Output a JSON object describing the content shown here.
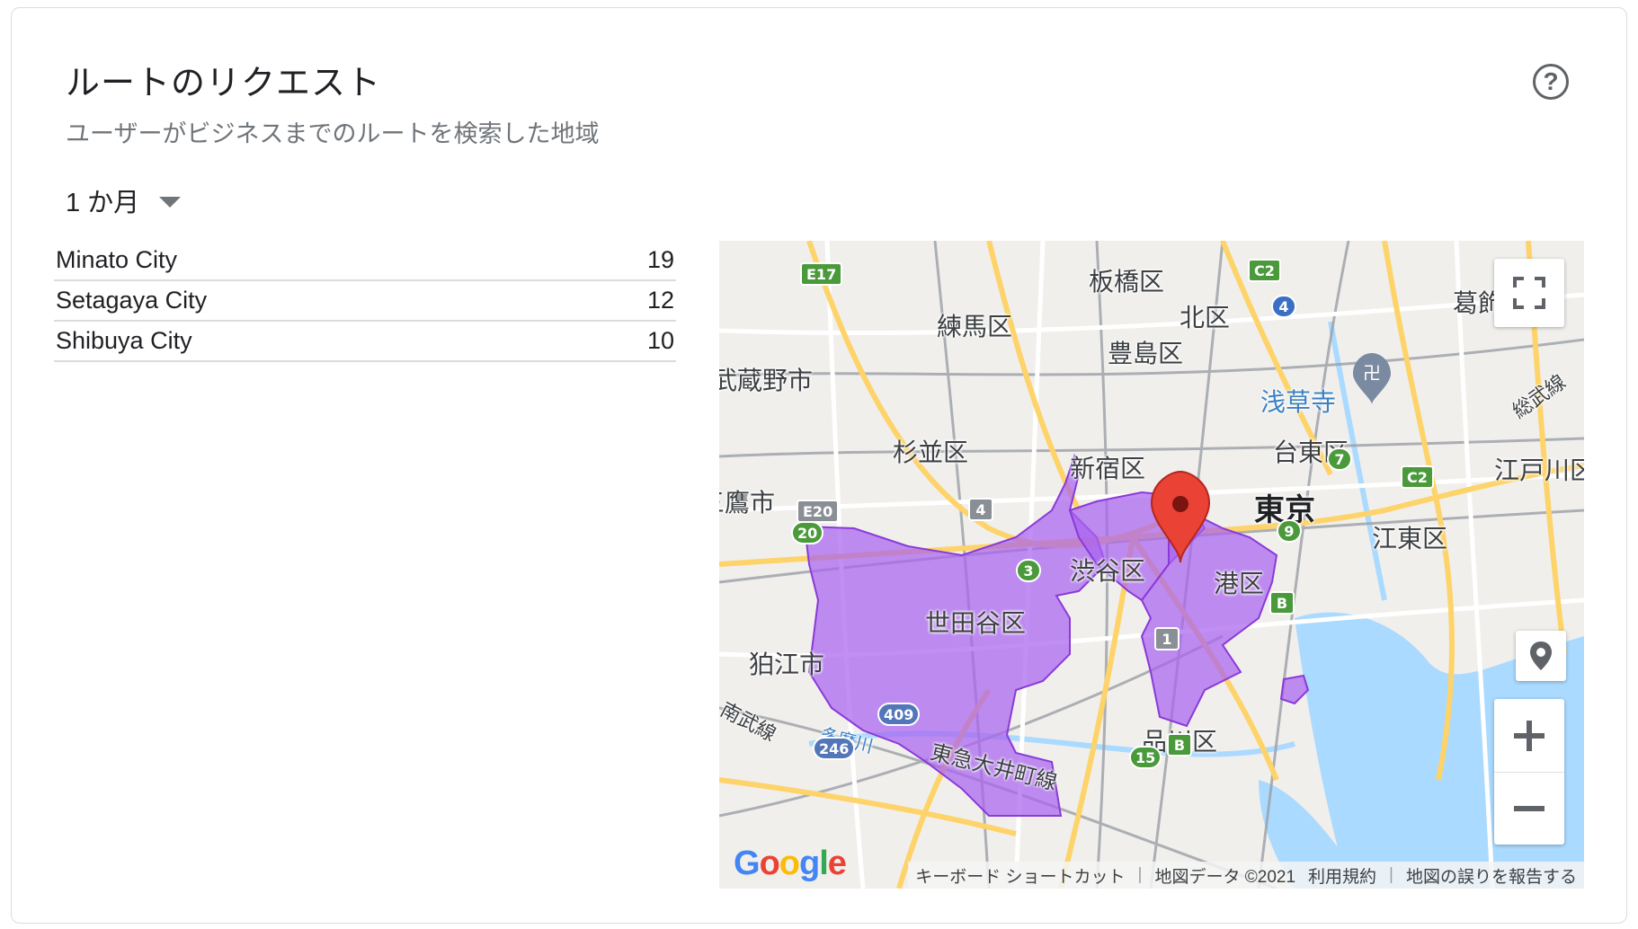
{
  "card": {
    "title": "ルートのリクエスト",
    "subtitle": "ユーザーがビジネスまでのルートを検索した地域",
    "period": "1 か月"
  },
  "list": {
    "rows": [
      {
        "name": "Minato City",
        "count": "19"
      },
      {
        "name": "Setagaya City",
        "count": "12"
      },
      {
        "name": "Shibuya City",
        "count": "10"
      }
    ]
  },
  "map": {
    "labels": {
      "itabashi": "板橋区",
      "kita": "北区",
      "nerima": "練馬区",
      "toshima": "豊島区",
      "katsushika": "葛飾",
      "musashino": "武蔵野市",
      "asakusa": "浅草寺",
      "sobu": "総武線",
      "suginami": "杉並区",
      "shinjuku": "新宿区",
      "taito": "台東区",
      "edogawa": "江戸川区",
      "tokyo": "東京",
      "mitaka": "三鷹市",
      "koto": "江東区",
      "shibuya": "渋谷区",
      "minato": "港区",
      "setagaya": "世田谷区",
      "komae": "狛江市",
      "nambu": "南武線",
      "tamagawa": "多摩川",
      "toyoko": "東急大井町線",
      "shinagawa": "品川区"
    },
    "shields": [
      "E17",
      "C2",
      "4",
      "7",
      "C2",
      "E20",
      "4",
      "20",
      "9",
      "3",
      "B",
      "1",
      "409",
      "246",
      "15",
      "B"
    ],
    "attribution": {
      "shortcuts": "キーボード ショートカット",
      "data": "地図データ ©2021",
      "terms": "利用規約",
      "report": "地図の誤りを報告する"
    },
    "google_letters": [
      "G",
      "o",
      "o",
      "g",
      "l",
      "e"
    ],
    "colors": {
      "highlight": "#a962f0",
      "pin": "#ea4335",
      "water": "#aadaff",
      "road": "#fdd36a"
    },
    "icons": {
      "fullscreen": "fullscreen-icon",
      "pegman": "location-pin-icon",
      "zoom_in": "plus-icon",
      "zoom_out": "minus-icon",
      "temple": "temple-icon"
    }
  }
}
